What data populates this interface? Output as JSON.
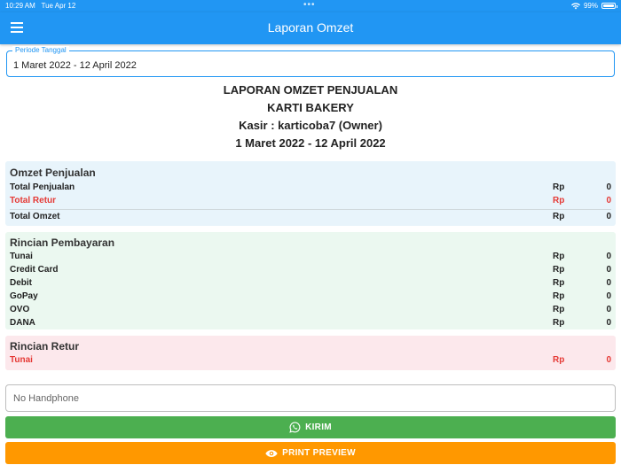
{
  "status": {
    "time": "10:29 AM",
    "date": "Tue Apr 12",
    "battery": "99%"
  },
  "appbar": {
    "title": "Laporan Omzet"
  },
  "period": {
    "label": "Periode Tanggal",
    "value": "1 Maret 2022 - 12 April 2022"
  },
  "report": {
    "line1": "LAPORAN OMZET PENJUALAN",
    "line2": "KARTI BAKERY",
    "line3": "Kasir : karticoba7 (Owner)",
    "line4": "1 Maret 2022 - 12 April 2022"
  },
  "omzet": {
    "title": "Omzet Penjualan",
    "rows": [
      {
        "label": "Total Penjualan",
        "currency": "Rp",
        "amount": "0"
      },
      {
        "label": "Total Retur",
        "currency": "Rp",
        "amount": "0"
      }
    ],
    "total": {
      "label": "Total Omzet",
      "currency": "Rp",
      "amount": "0"
    }
  },
  "pembayaran": {
    "title": "Rincian Pembayaran",
    "rows": [
      {
        "label": "Tunai",
        "currency": "Rp",
        "amount": "0"
      },
      {
        "label": "Credit Card",
        "currency": "Rp",
        "amount": "0"
      },
      {
        "label": "Debit",
        "currency": "Rp",
        "amount": "0"
      },
      {
        "label": "GoPay",
        "currency": "Rp",
        "amount": "0"
      },
      {
        "label": "OVO",
        "currency": "Rp",
        "amount": "0"
      },
      {
        "label": "DANA",
        "currency": "Rp",
        "amount": "0"
      }
    ]
  },
  "retur": {
    "title": "Rincian Retur",
    "rows": [
      {
        "label": "Tunai",
        "currency": "Rp",
        "amount": "0"
      }
    ]
  },
  "phone": {
    "placeholder": "No Handphone"
  },
  "buttons": {
    "kirim": "KIRIM",
    "print": "PRINT PREVIEW"
  },
  "colors": {
    "primary": "#2196f3",
    "kirim": "#4caf50",
    "print": "#ff9800",
    "negative": "#e53935"
  },
  "icons": {
    "menu": "hamburger-menu-icon",
    "kirim": "whatsapp-icon",
    "print": "eye-icon"
  }
}
